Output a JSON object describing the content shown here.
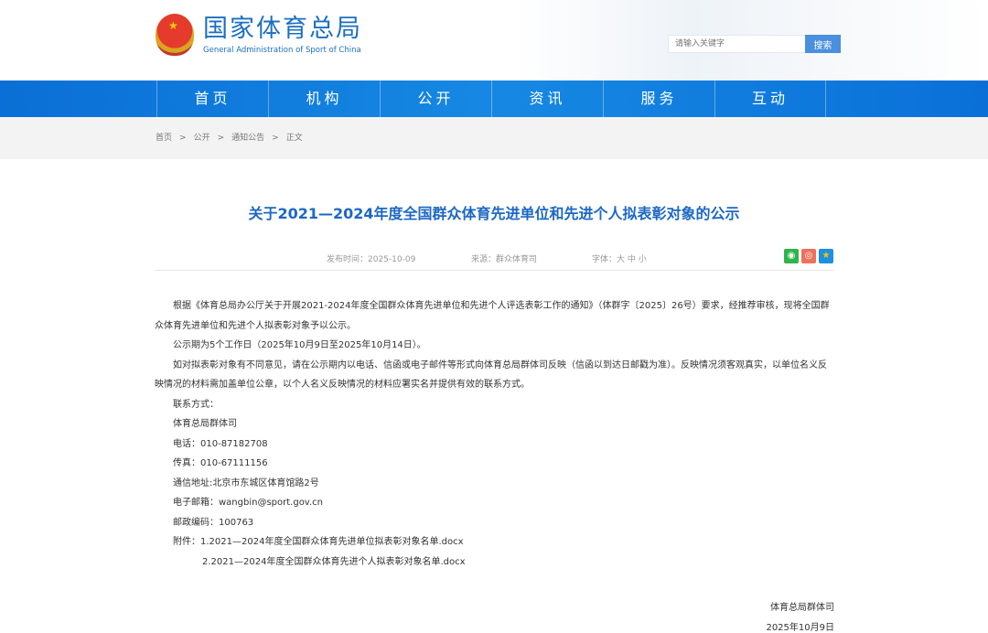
{
  "header": {
    "site_name_cn": "国家体育总局",
    "site_name_en": "General Administration of Sport of China",
    "search_placeholder": "请输入关键字",
    "search_button": "搜索"
  },
  "nav": [
    "首页",
    "机构",
    "公开",
    "资讯",
    "服务",
    "互动"
  ],
  "breadcrumb": [
    "首页",
    "公开",
    "通知公告",
    "正文"
  ],
  "breadcrumb_sep": ">",
  "article": {
    "title": "关于2021—2024年度全国群众体育先进单位和先进个人拟表彰对象的公示",
    "publish": "发布时间：2025-10-09",
    "source": "来源：群众体育司",
    "font_label": "字体：",
    "font_sizes": [
      "大",
      "中",
      "小"
    ],
    "share": [
      "wechat",
      "weibo",
      "favorite"
    ],
    "paragraphs": [
      "根据《体育总局办公厅关于开展2021-2024年度全国群众体育先进单位和先进个人评选表彰工作的通知》（体群字〔2025〕26号）要求，经推荐审核，现将全国群众体育先进单位和先进个人拟表彰对象予以公示。",
      "公示期为5个工作日（2025年10月9日至2025年10月14日）。",
      "如对拟表彰对象有不同意见，请在公示期内以电话、信函或电子邮件等形式向体育总局群体司反映（信函以到达日邮戳为准）。反映情况须客观真实，以单位名义反映情况的材料需加盖单位公章，以个人名义反映情况的材料应署实名并提供有效的联系方式。"
    ],
    "contacts": [
      "联系方式：",
      "体育总局群体司",
      "电话：010-87182708",
      "传真：010-67111156",
      "通信地址:北京市东城区体育馆路2号",
      "电子邮箱：wangbin@sport.gov.cn",
      "邮政编码：100763"
    ],
    "attachments": [
      "附件：1.2021—2024年度全国群众体育先进单位拟表彰对象名单.docx",
      "2.2021—2024年度全国群众体育先进个人拟表彰对象名单.docx"
    ],
    "signature": "体育总局群体司",
    "date": "2025年10月9日"
  }
}
